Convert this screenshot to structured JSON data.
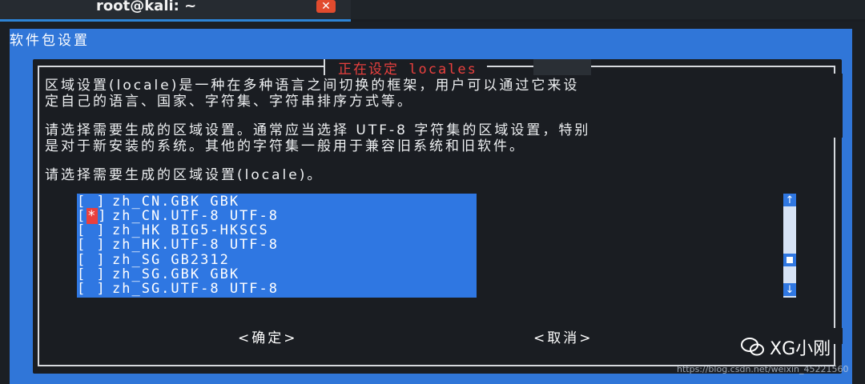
{
  "window": {
    "title": "root@kali: ~",
    "close_label": "✕"
  },
  "panel": {
    "title": "软件包设置"
  },
  "dialog": {
    "heading": "正在设定 locales",
    "paragraphs": [
      "区域设置(locale)是一种在多种语言之间切换的框架，用户可以通过它来设",
      "定自己的语言、国家、字符集、字符串排序方式等。",
      "请选择需要生成的区域设置。通常应当选择 UTF-8 字符集的区域设置，特别",
      "是对于新安装的系统。其他的字符集一般用于兼容旧系统和旧软件。",
      "请选择需要生成的区域设置(locale)。"
    ],
    "items": [
      {
        "checkbox": "[ ]",
        "checked": false,
        "label": "zh_CN.GBK GBK"
      },
      {
        "checkbox": "[*]",
        "checked": true,
        "label": "zh_CN.UTF-8 UTF-8"
      },
      {
        "checkbox": "[ ]",
        "checked": false,
        "label": "zh_HK BIG5-HKSCS"
      },
      {
        "checkbox": "[ ]",
        "checked": false,
        "label": "zh_HK.UTF-8 UTF-8"
      },
      {
        "checkbox": "[ ]",
        "checked": false,
        "label": "zh_SG GB2312"
      },
      {
        "checkbox": "[ ]",
        "checked": false,
        "label": "zh_SG.GBK GBK"
      },
      {
        "checkbox": "[ ]",
        "checked": false,
        "label": "zh_SG.UTF-8 UTF-8"
      }
    ],
    "ok_label": "<确定>",
    "cancel_label": "<取消>",
    "scroll_up": "↑",
    "scroll_down": "↓"
  },
  "overlay": {
    "brand": "XG小刚",
    "url": "https://blog.csdn.net/weixin_45221560"
  },
  "colors": {
    "panel_blue": "#3076d8",
    "highlight_blue": "#2f77e2",
    "heading_red": "#e8403e"
  }
}
